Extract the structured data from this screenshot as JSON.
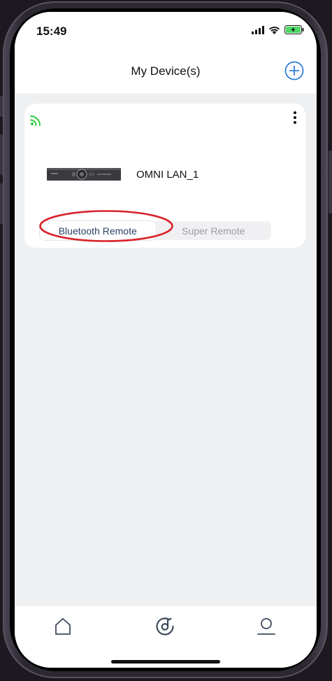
{
  "status_bar": {
    "time": "15:49",
    "icons": [
      "cellular-signal-icon",
      "wifi-icon",
      "battery-charging-icon"
    ],
    "battery_color": "#4cd964"
  },
  "header": {
    "title": "My Device(s)",
    "add_icon": "plus-circle-icon",
    "accent_color": "#2f7fd8"
  },
  "device_card": {
    "connection_icon": "wifi-signal-icon",
    "connection_color": "#2ecc40",
    "more_icon": "vertical-ellipsis-icon",
    "device_name": "OMNI LAN_1",
    "remote_tabs": [
      {
        "label": "Bluetooth Remote",
        "selected": true
      },
      {
        "label": "Super Remote",
        "selected": false
      }
    ],
    "highlight_color": "#d8232a"
  },
  "bottom_tabs": [
    {
      "name": "home-icon"
    },
    {
      "name": "music-disc-icon"
    },
    {
      "name": "profile-icon"
    }
  ],
  "tab_icon_color": "#3d4a5c"
}
